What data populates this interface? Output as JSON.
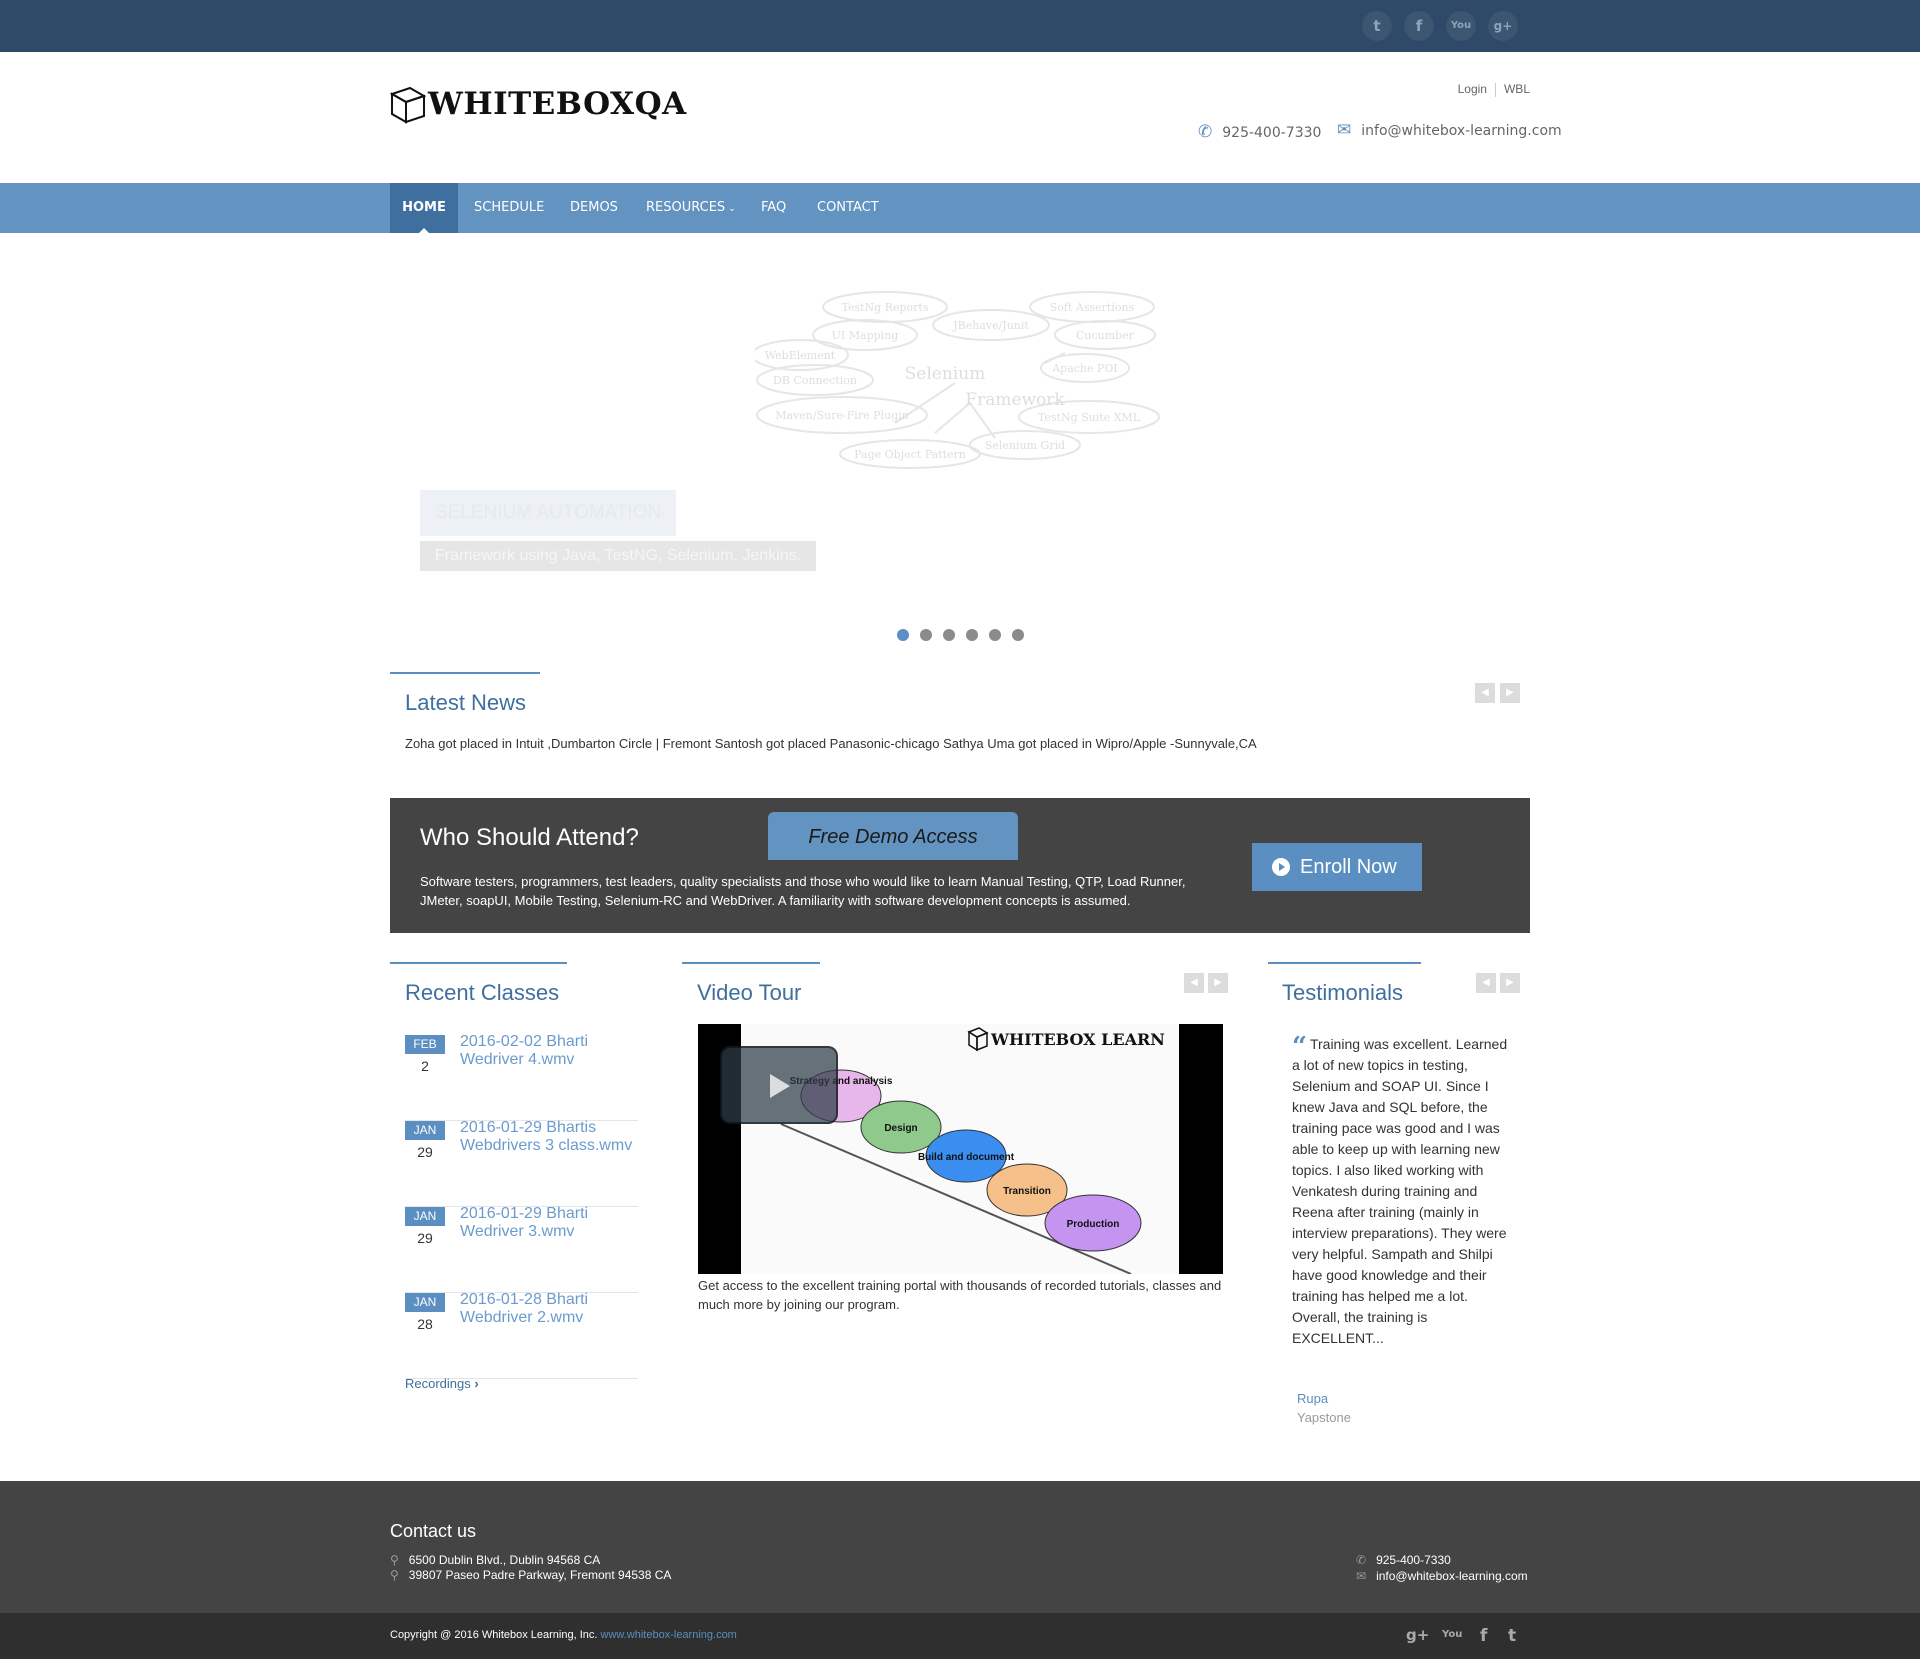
{
  "social": {
    "twitter": "twitter-icon",
    "facebook": "facebook-icon",
    "youtube": "youtube-icon",
    "googleplus": "googleplus-icon"
  },
  "logo": {
    "text": "WHITEBOXQA"
  },
  "toplinks": {
    "login": "Login",
    "wbl": "WBL"
  },
  "contact": {
    "phone": "925-400-7330",
    "email": "info@whitebox-learning.com"
  },
  "nav": {
    "items": [
      "HOME",
      "SCHEDULE",
      "DEMOS",
      "RESOURCES",
      "FAQ",
      "CONTACT"
    ],
    "active": "HOME"
  },
  "slider": {
    "title": "SELENIUM AUTOMATION",
    "subtitle": "Framework using Java, TestNG, Selenium, Jenkins.",
    "mindmap": {
      "center1": "Selenium",
      "center2": "Framework",
      "bubbles": [
        "TestNg Reports",
        "JBehave/Junit",
        "Soft Assertions",
        "UI Mapping",
        "Cucumber",
        "WebElement",
        "Apache POI",
        "DB Connection",
        "Maven/Sure-Fire Plugin",
        "TestNg Suite XML",
        "Page Object Pattern",
        "Selenium Grid"
      ]
    },
    "dots": 6,
    "active_dot": 0
  },
  "news": {
    "title": "Latest News",
    "text": "Zoha got placed in Intuit ,Dumbarton Circle | Fremont Santosh got placed Panasonic-chicago Sathya Uma got placed in Wipro/Apple -Sunnyvale,CA"
  },
  "attend": {
    "title": "Who Should Attend?",
    "demo_tab": "Free Demo Access",
    "text": "Software testers, programmers, test leaders, quality specialists and those who would like to learn Manual Testing, QTP, Load Runner, JMeter, soapUI, Mobile Testing, Selenium-RC and WebDriver. A familiarity with software development concepts is assumed.",
    "enroll": "Enroll Now"
  },
  "recent": {
    "title": "Recent Classes",
    "items": [
      {
        "month": "FEB",
        "day": "2",
        "title": "2016-02-02 Bharti Wedriver 4.wmv"
      },
      {
        "month": "JAN",
        "day": "29",
        "title": "2016-01-29 Bhartis Webdrivers 3 class.wmv"
      },
      {
        "month": "JAN",
        "day": "29",
        "title": "2016-01-29 Bharti Wedriver 3.wmv"
      },
      {
        "month": "JAN",
        "day": "28",
        "title": "2016-01-28 Bharti Webdriver 2.wmv"
      }
    ],
    "recordings": "Recordings"
  },
  "video": {
    "title": "Video Tour",
    "watermark": "WHITEBOX LEARN",
    "stages": [
      "Strategy and analysis",
      "Design",
      "Build and document",
      "Transition",
      "Production"
    ],
    "caption": "Get access to the excellent training portal with thousands of recorded tutorials, classes and much more by joining our program."
  },
  "testimonials": {
    "title": "Testimonials",
    "text": "Training was excellent. Learned a lot of new topics in testing, Selenium and SOAP UI. Since I knew Java and SQL before, the training pace was good and I was able to keep up with learning new topics. I also liked working with Venkatesh during training and Reena after training (mainly in interview preparations). They were very helpful. Sampath and Shilpi have good knowledge and their training has helped me a lot. Overall, the training is EXCELLENT...",
    "name": "Rupa",
    "company": "Yapstone"
  },
  "footer": {
    "title": "Contact us",
    "address1": "6500 Dublin Blvd., Dublin 94568 CA",
    "address2": "39807 Paseo Padre Parkway, Fremont 94538 CA",
    "phone": "925-400-7330",
    "email": "info@whitebox-learning.com",
    "copyright": "Copyright @ 2016 Whitebox Learning, Inc.",
    "site": "www.whitebox-learning.com"
  },
  "colors": {
    "topbar": "#2e4a68",
    "nav": "#6293c1",
    "nav_active": "#3f6f9f",
    "accent": "#5b8ec1",
    "dark_panel": "#444444"
  }
}
